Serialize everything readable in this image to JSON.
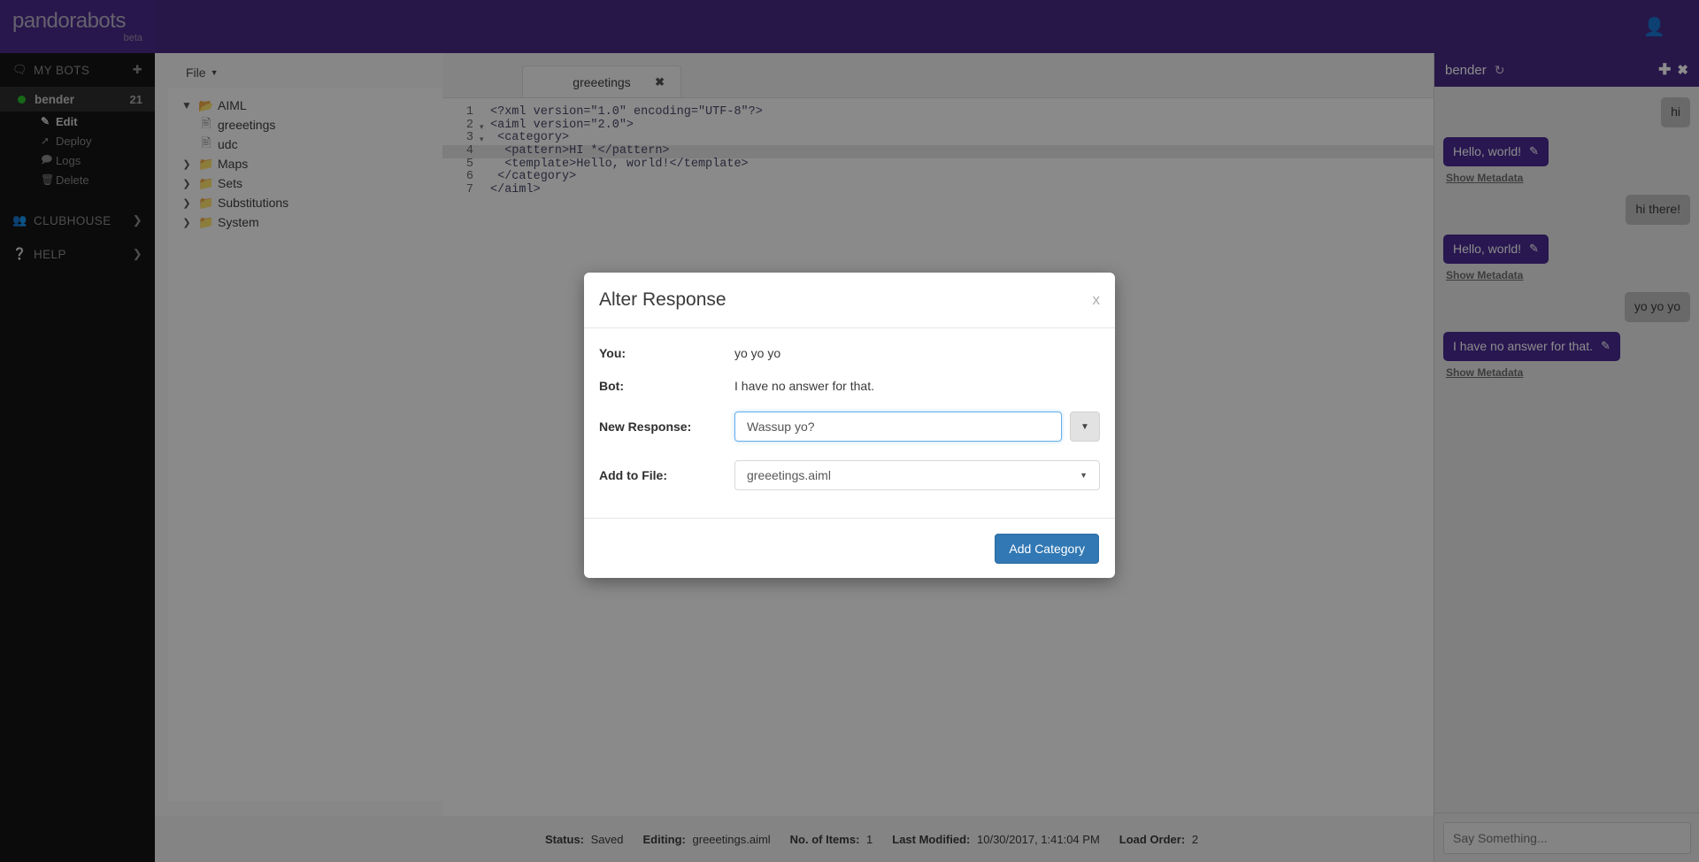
{
  "brand": {
    "name": "pandorabots",
    "beta": "beta",
    "logo_bg": "#4a2a8a"
  },
  "topbar": {
    "user_icon": "user-icon"
  },
  "sidebar": {
    "my_bots": {
      "label": "MY BOTS",
      "icon": "chat-bubbles-icon",
      "add_icon": "plus-circle-icon"
    },
    "bot": {
      "name": "bender",
      "count": "21",
      "status_icon": "online-dot-icon"
    },
    "bot_actions": [
      {
        "label": "Edit",
        "icon": "pencil-square-icon",
        "active": true
      },
      {
        "label": "Deploy",
        "icon": "rocket-icon",
        "active": false
      },
      {
        "label": "Logs",
        "icon": "comment-icon",
        "active": false
      },
      {
        "label": "Delete",
        "icon": "trash-icon",
        "active": false
      }
    ],
    "sections": [
      {
        "label": "CLUBHOUSE",
        "icon": "people-group-icon",
        "chevron": "❯"
      },
      {
        "label": "HELP",
        "icon": "question-circle-icon",
        "chevron": "❯"
      }
    ]
  },
  "tree_panel": {
    "file_menu": "File",
    "nodes": [
      {
        "label": "AIML",
        "type": "folder",
        "expanded": true,
        "depth": 0
      },
      {
        "label": "greeetings",
        "type": "file",
        "expanded": null,
        "depth": 1
      },
      {
        "label": "udc",
        "type": "file",
        "expanded": null,
        "depth": 1
      },
      {
        "label": "Maps",
        "type": "folder",
        "expanded": false,
        "depth": 0
      },
      {
        "label": "Sets",
        "type": "folder",
        "expanded": false,
        "depth": 0
      },
      {
        "label": "Substitutions",
        "type": "folder",
        "expanded": false,
        "depth": 0
      },
      {
        "label": "System",
        "type": "folder",
        "expanded": false,
        "depth": 0
      }
    ]
  },
  "editor": {
    "tab": {
      "label": "greeetings",
      "close_icon": "close-icon"
    },
    "lines": [
      {
        "num": "1",
        "fold": "",
        "highlighted": false,
        "text": "<?xml version=\"1.0\" encoding=\"UTF-8\"?>"
      },
      {
        "num": "2",
        "fold": "▾",
        "highlighted": false,
        "text": "<aiml version=\"2.0\">"
      },
      {
        "num": "3",
        "fold": "▾",
        "highlighted": false,
        "text": " <category>"
      },
      {
        "num": "4",
        "fold": "",
        "highlighted": true,
        "text": "  <pattern>HI *</pattern>"
      },
      {
        "num": "5",
        "fold": "",
        "highlighted": false,
        "text": "  <template>Hello, world!</template>"
      },
      {
        "num": "6",
        "fold": "",
        "highlighted": false,
        "text": " </category>"
      },
      {
        "num": "7",
        "fold": "",
        "highlighted": false,
        "text": "</aiml>"
      }
    ]
  },
  "statusbar": {
    "items": [
      {
        "label": "Status:",
        "value": "Saved"
      },
      {
        "label": "Editing:",
        "value": "greeetings.aiml"
      },
      {
        "label": "No. of Items:",
        "value": "1"
      },
      {
        "label": "Last Modified:",
        "value": "10/30/2017, 1:41:04 PM"
      },
      {
        "label": "Load Order:",
        "value": "2"
      }
    ]
  },
  "chat": {
    "header": {
      "title": "bender",
      "refresh_icon": "refresh-icon",
      "add_icon": "plus-icon",
      "close_icon": "close-icon"
    },
    "messages": [
      {
        "side": "user",
        "text": "hi",
        "edit": false,
        "metadata": null
      },
      {
        "side": "bot",
        "text": "Hello, world!",
        "edit": true,
        "metadata": "Show Metadata"
      },
      {
        "side": "user",
        "text": "hi there!",
        "edit": false,
        "metadata": null
      },
      {
        "side": "bot",
        "text": "Hello, world!",
        "edit": true,
        "metadata": "Show Metadata"
      },
      {
        "side": "user",
        "text": "yo yo yo",
        "edit": false,
        "metadata": null
      },
      {
        "side": "bot",
        "text": "I have no answer for that.",
        "edit": true,
        "metadata": "Show Metadata"
      }
    ],
    "input_placeholder": "Say Something..."
  },
  "modal": {
    "title": "Alter Response",
    "close_label": "x",
    "rows": {
      "you_label": "You:",
      "you_value": "yo yo yo",
      "bot_label": "Bot:",
      "bot_value": "I have no answer for that.",
      "new_response_label": "New Response:",
      "new_response_value": "Wassup yo?",
      "add_to_file_label": "Add to File:",
      "add_to_file_value": "greeetings.aiml"
    },
    "submit_label": "Add Category"
  },
  "colors": {
    "purple": "#472a85",
    "bubble_purple": "#4a2a93",
    "primary_blue": "#3178b4",
    "online_green": "#2bbd2b"
  }
}
